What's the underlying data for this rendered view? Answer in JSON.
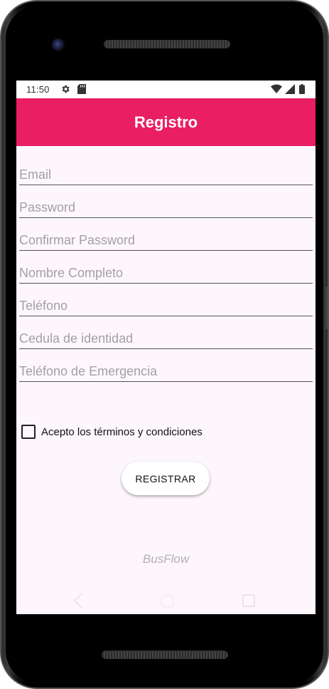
{
  "status_bar": {
    "time": "11:50",
    "icons": [
      "gear-icon",
      "sd-card-icon",
      "wifi-icon",
      "signal-icon",
      "battery-icon"
    ]
  },
  "app_bar": {
    "title": "Registro",
    "color": "#e91e63"
  },
  "form": {
    "fields": [
      {
        "placeholder": "Email",
        "value": ""
      },
      {
        "placeholder": "Password",
        "value": ""
      },
      {
        "placeholder": "Confirmar Password",
        "value": ""
      },
      {
        "placeholder": "Nombre Completo",
        "value": ""
      },
      {
        "placeholder": "Teléfono",
        "value": ""
      },
      {
        "placeholder": "Cedula de identidad",
        "value": ""
      },
      {
        "placeholder": "Teléfono de Emergencia",
        "value": ""
      }
    ],
    "terms_label": "Acepto los términos y condiciones",
    "terms_checked": false,
    "register_label": "REGISTRAR"
  },
  "footer": {
    "brand": "BusFlow"
  },
  "nav_bar": {
    "icons": [
      "back-icon",
      "home-icon",
      "recents-icon"
    ]
  }
}
